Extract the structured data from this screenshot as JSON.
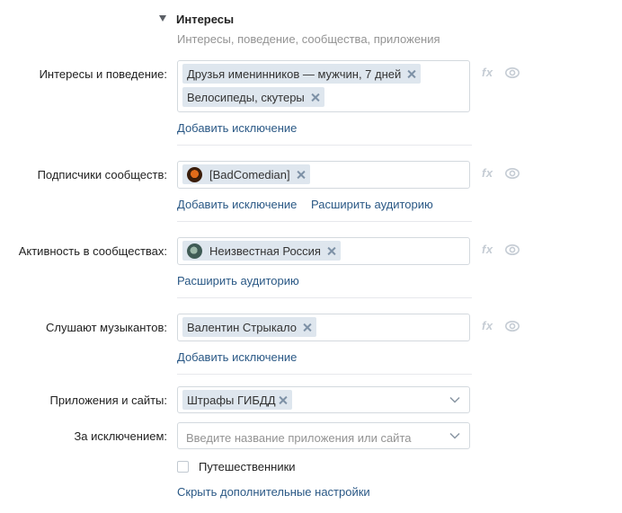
{
  "section": {
    "title": "Интересы",
    "subtitle": "Интересы, поведение, сообщества, приложения"
  },
  "interests": {
    "label": "Интересы и поведение:",
    "tags": [
      "Друзья именинников — мужчин, 7 дней",
      "Велосипеды, скутеры"
    ],
    "add_exclusion": "Добавить исключение"
  },
  "subscribers": {
    "label": "Подписчики сообществ:",
    "tags": [
      "[BadComedian]"
    ],
    "add_exclusion": "Добавить исключение",
    "expand": "Расширить аудиторию"
  },
  "activity": {
    "label": "Активность в сообществах:",
    "tags": [
      "Неизвестная Россия"
    ],
    "expand": "Расширить аудиторию"
  },
  "musicians": {
    "label": "Слушают музыкантов:",
    "tags": [
      "Валентин Стрыкало"
    ],
    "add_exclusion": "Добавить исключение"
  },
  "apps": {
    "label": "Приложения и сайты:",
    "tags": [
      "Штрафы ГИБДД"
    ]
  },
  "except": {
    "label": "За исключением:",
    "placeholder": "Введите название приложения или сайта"
  },
  "travelers": {
    "label": "Путешественники",
    "checked": false
  },
  "hide_advanced": "Скрыть дополнительные настройки",
  "fx_label": "fx",
  "icons": {
    "fx": "fx-icon",
    "eye": "eye-icon",
    "close": "close-icon",
    "chevron": "chevron-down-icon"
  }
}
